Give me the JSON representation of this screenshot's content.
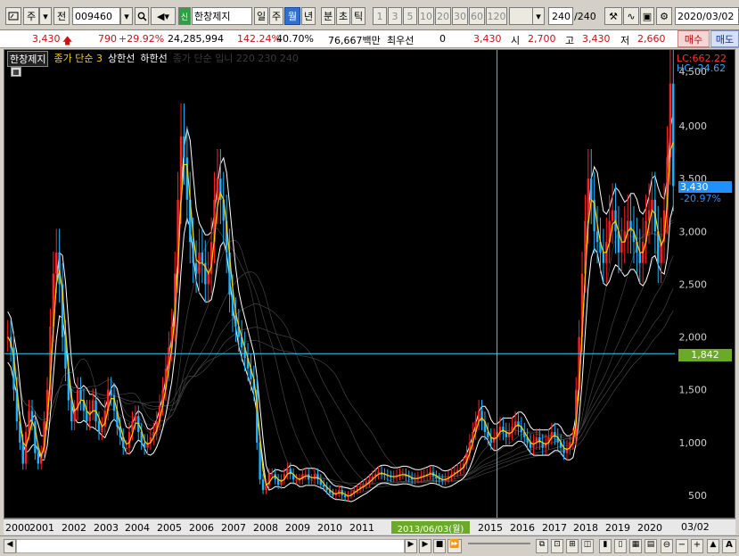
{
  "toolbar": {
    "market": "주",
    "prev_label": "전",
    "code": "009460",
    "new_badge": "신",
    "stock_name": "한창제지",
    "periods": [
      "일",
      "주",
      "월",
      "년",
      "분",
      "초",
      "틱"
    ],
    "active_period": "월",
    "intervals": [
      "1",
      "3",
      "5",
      "10",
      "20",
      "30",
      "60",
      "120"
    ],
    "count": "240",
    "count_total": "/240",
    "date": "2020/03/02"
  },
  "quote": {
    "price": "3,430",
    "change": "790",
    "change_pct": "+29.92%",
    "volume": "24,285,994",
    "volume_ratio": "142.24%",
    "turnover": "40.70%",
    "amount": "76,667백만",
    "priority_label": "최우선",
    "priority_value": "0",
    "current": "3,430",
    "open_label": "시",
    "open": "2,700",
    "high_label": "고",
    "high": "3,430",
    "low_label": "저",
    "low": "2,660",
    "buy_label": "매수",
    "sell_label": "매도"
  },
  "legend": {
    "name": "한창제지",
    "ma_label": "종가 단순 3",
    "upper_label": "상한선",
    "lower_label": "하한선",
    "faded_label": "종가 단순 입니 220 230 240"
  },
  "price_axis": {
    "ticks": [
      "4,000",
      "3,500",
      "3,000",
      "2,500",
      "2,000",
      "1,500",
      "1,000",
      "500"
    ],
    "top_partial": "4,500",
    "lc": "LC:662.22",
    "hc": "HC:-24.62",
    "current_price": "3,430",
    "current_pct": "-20.97%",
    "cursor_price": "1,842"
  },
  "time_axis": {
    "years": [
      "2000",
      "2001",
      "2002",
      "2003",
      "2004",
      "2005",
      "2006",
      "2007",
      "2008",
      "2009",
      "2010",
      "2011",
      "2015",
      "2016",
      "2017",
      "2018",
      "2019",
      "2020"
    ],
    "cursor_date": "2013/06/03(월)",
    "right_label": "03/02"
  },
  "colors": {
    "up": "#ff2020",
    "down": "#1eb4ff",
    "ma": "#ffd000",
    "band": "#ffffff",
    "crosshair": "#33ccff"
  },
  "chart_data": {
    "type": "candlestick",
    "title": "한창제지",
    "x_range": [
      "2000",
      "2020/03"
    ],
    "ylim": [
      300,
      4600
    ],
    "monthly_close": [
      2000,
      1900,
      1500,
      1200,
      1000,
      800,
      1100,
      1300,
      1200,
      900,
      800,
      900,
      1200,
      1500,
      2100,
      2600,
      2800,
      2500,
      2000,
      1700,
      1400,
      1200,
      1300,
      1500,
      1400,
      1300,
      1200,
      1300,
      1400,
      1200,
      1100,
      1150,
      1300,
      1500,
      1450,
      1300,
      1150,
      1050,
      950,
      950,
      1100,
      1200,
      1250,
      1100,
      1000,
      950,
      1000,
      1050,
      1100,
      1200,
      1350,
      1500,
      1700,
      1900,
      2100,
      2600,
      3300,
      3900,
      3700,
      3300,
      2900,
      2700,
      2600,
      2800,
      2700,
      2500,
      2600,
      2900,
      3300,
      3500,
      3300,
      3100,
      2800,
      2400,
      2200,
      2100,
      2000,
      1900,
      1800,
      1700,
      1600,
      1500,
      1000,
      650,
      550,
      600,
      700,
      700,
      650,
      600,
      650,
      700,
      750,
      700,
      650,
      650,
      650,
      700,
      700,
      650,
      650,
      700,
      650,
      600,
      580,
      550,
      520,
      500,
      520,
      550,
      500,
      480,
      500,
      520,
      550,
      560,
      580,
      600,
      620,
      650,
      680,
      700,
      720,
      700,
      690,
      680,
      670,
      680,
      690,
      700,
      700,
      680,
      670,
      650,
      660,
      670,
      680,
      690,
      700,
      720,
      680,
      660,
      650,
      640,
      660,
      680,
      700,
      720,
      740,
      760,
      800,
      900,
      1000,
      1100,
      1200,
      1300,
      1200,
      1100,
      1050,
      1000,
      1050,
      1100,
      1150,
      1100,
      1050,
      1100,
      1150,
      1200,
      1150,
      1100,
      1050,
      1000,
      950,
      1000,
      1050,
      1000,
      950,
      1000,
      1050,
      1100,
      1050,
      1000,
      950,
      900,
      950,
      1000,
      1050,
      1500,
      2000,
      2600,
      3100,
      3500,
      3300,
      3000,
      2900,
      2800,
      2700,
      2900,
      3100,
      3200,
      3000,
      2800,
      2900,
      3000,
      3100,
      3000,
      2900,
      2800,
      2700,
      2900,
      3100,
      3200,
      3300,
      3000,
      2700,
      2900,
      3200,
      3700,
      4400,
      3430
    ],
    "yticks": [
      4000,
      3500,
      3000,
      2500,
      2000,
      1500,
      1000,
      500
    ],
    "crosshair": {
      "date": "2013/06/03",
      "price": 1842
    },
    "last": {
      "close": 3430,
      "open": 2700,
      "high": 3430,
      "low": 2660
    }
  }
}
